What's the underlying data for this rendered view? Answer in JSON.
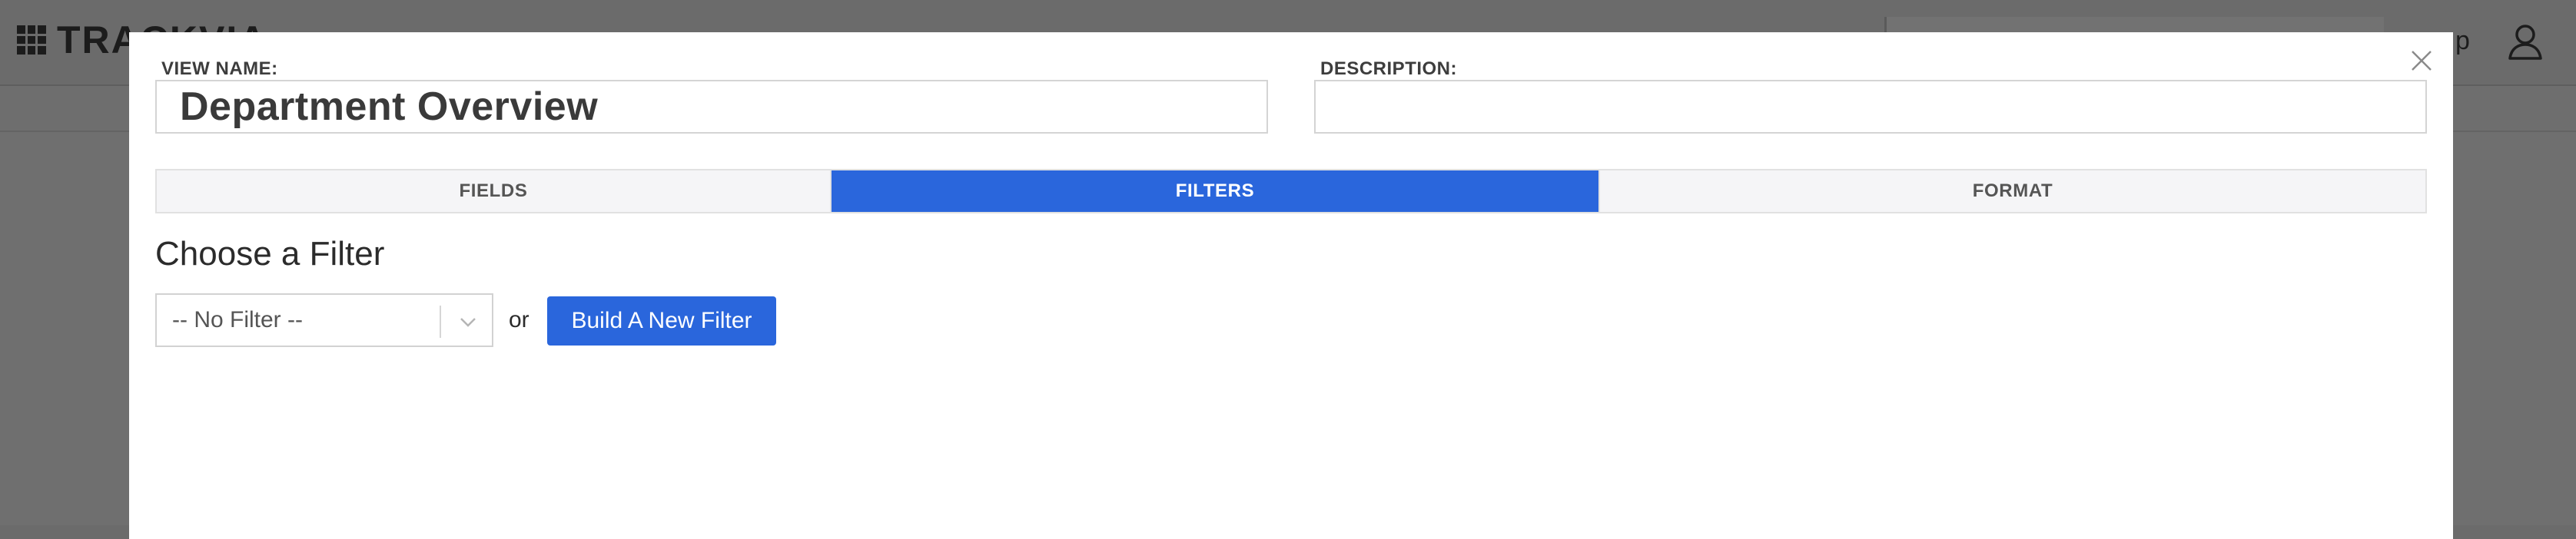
{
  "app": {
    "logo_text": "TRACKVIA",
    "header_right_text": "p"
  },
  "modal": {
    "view_name": {
      "label": "VIEW NAME:",
      "value": "Department Overview"
    },
    "description": {
      "label": "DESCRIPTION:",
      "value": ""
    },
    "tabs": [
      {
        "label": "FIELDS",
        "active": false
      },
      {
        "label": "FILTERS",
        "active": true
      },
      {
        "label": "FORMAT",
        "active": false
      }
    ],
    "filter_section": {
      "title": "Choose a Filter",
      "select_value": "-- No Filter --",
      "or_text": "or",
      "build_button_label": "Build A New Filter"
    }
  },
  "colors": {
    "accent": "#2a66dc",
    "overlay": "#6b6b6b"
  },
  "icons": [
    "logo-grid-icon",
    "user-icon",
    "close-icon",
    "chevron-down-icon"
  ]
}
